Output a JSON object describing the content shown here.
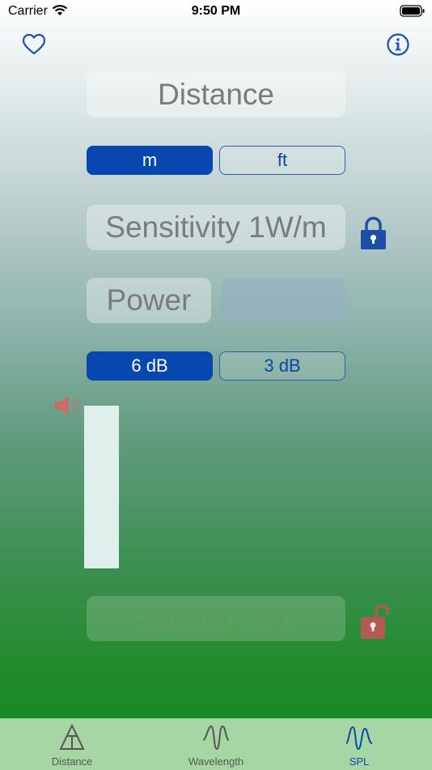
{
  "status": {
    "carrier": "Carrier",
    "time": "9:50 PM"
  },
  "fields": {
    "distance": "Distance",
    "sensitivity": "Sensitivity 1W/m",
    "power": "Power",
    "power_value": "",
    "second_spl": "Second SPL"
  },
  "units": {
    "meters": "m",
    "feet": "ft",
    "selected": "m"
  },
  "doubling": {
    "six": "6 dB",
    "three": "3 dB",
    "selected": "6 dB"
  },
  "tabs": [
    {
      "label": "Distance",
      "icon": "distance-triangle-icon"
    },
    {
      "label": "Wavelength",
      "icon": "wavelength-wave-icon"
    },
    {
      "label": "SPL",
      "icon": "spl-wave-icon",
      "selected": true
    }
  ],
  "icons": {
    "favorite": "heart-icon",
    "info": "info-icon",
    "lock_locked": "lock-closed-icon",
    "lock_unlocked": "lock-open-icon",
    "speaker": "speaker-icon"
  },
  "colors": {
    "accent": "#0847b0",
    "lock_blue": "#1c4fa8",
    "lock_red": "#b35a55",
    "tabbar": "#a6d6a3"
  }
}
